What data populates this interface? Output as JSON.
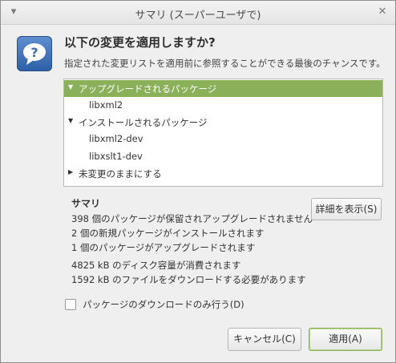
{
  "window": {
    "title": "サマリ (スーパーユーザで)",
    "menu_icon": "chevron-down-icon",
    "close_icon": "close-icon"
  },
  "header": {
    "icon": "question-icon",
    "heading": "以下の変更を適用しますか?",
    "subtext": "指定された変更リストを適用前に参照することができる最後のチャンスです。"
  },
  "tree": {
    "rows": [
      {
        "label": "アップグレードされるパッケージ",
        "expander": "expanded-arrow-icon",
        "selected": true
      },
      {
        "label": "libxml2",
        "expander": "",
        "selected": false
      },
      {
        "label": "インストールされるパッケージ",
        "expander": "expanded-arrow-icon",
        "selected": false
      },
      {
        "label": "libxml2-dev",
        "expander": "",
        "selected": false
      },
      {
        "label": "libxslt1-dev",
        "expander": "",
        "selected": false
      },
      {
        "label": "未変更のままにする",
        "expander": "collapsed-arrow-icon",
        "selected": false
      }
    ]
  },
  "summary": {
    "title": "サマリ",
    "lines": [
      "398 個のパッケージが保留されアップグレードされません",
      "2 個の新規パッケージがインストールされます",
      "1 個のパッケージがアップグレードされます",
      "4825 kB のディスク容量が消費されます",
      "1592 kB のファイルをダウンロードする必要があります"
    ],
    "details_button": "詳細を表示(S)"
  },
  "download_only": {
    "label": "パッケージのダウンロードのみ行う(D)",
    "checked": false
  },
  "footer": {
    "cancel": "キャンセル(C)",
    "apply": "適用(A)"
  },
  "colors": {
    "accent": "#8bb05a",
    "icon_blue": "#3a6db5"
  }
}
